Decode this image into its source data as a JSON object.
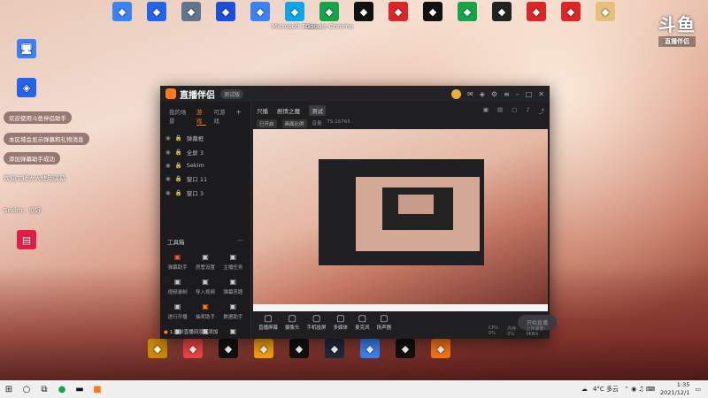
{
  "desktop_icons_top": [
    {
      "label": "",
      "icon": "user-icon",
      "color": "#3b82f6"
    },
    {
      "label": "",
      "icon": "computer-icon",
      "color": "#2563eb"
    },
    {
      "label": "",
      "icon": "recycle-icon",
      "color": "#64748b"
    },
    {
      "label": "",
      "icon": "app-icon",
      "color": "#1d4ed8"
    },
    {
      "label": "",
      "icon": "feishu-icon",
      "color": "#3b82f6"
    },
    {
      "label": "Microsoft Edge",
      "icon": "edge-icon",
      "color": "#0ea5e9"
    },
    {
      "label": "Google Chrome",
      "icon": "chrome-icon",
      "color": "#16a34a"
    },
    {
      "label": "",
      "icon": "capcut-icon",
      "color": "#111111"
    },
    {
      "label": "",
      "icon": "wps-icon",
      "color": "#dc2626"
    },
    {
      "label": "",
      "icon": "qq-icon",
      "color": "#111111"
    },
    {
      "label": "",
      "icon": "wechat-icon",
      "color": "#16a34a"
    },
    {
      "label": "",
      "icon": "obs-icon",
      "color": "#222222"
    },
    {
      "label": "",
      "icon": "wps-office-icon",
      "color": "#dc2626"
    },
    {
      "label": "",
      "icon": "netease-icon",
      "color": "#dc2626"
    },
    {
      "label": "",
      "icon": "folder-icon",
      "color": "#e5c07b"
    }
  ],
  "desktop_icons_bottom": [
    {
      "label": "",
      "icon": "app-a-icon",
      "color": "#ca8a04"
    },
    {
      "label": "",
      "icon": "app-b-icon",
      "color": "#ef4444"
    },
    {
      "label": "",
      "icon": "app-c-icon",
      "color": "#111111"
    },
    {
      "label": "",
      "icon": "app-d-icon",
      "color": "#f59e0b"
    },
    {
      "label": "",
      "icon": "app-e-icon",
      "color": "#111111"
    },
    {
      "label": "",
      "icon": "app-f-icon",
      "color": "#1e293b"
    },
    {
      "label": "",
      "icon": "app-g-icon",
      "color": "#3b82f6"
    },
    {
      "label": "",
      "icon": "app-h-icon",
      "color": "#111111"
    },
    {
      "label": "",
      "icon": "app-i-icon",
      "color": "#f97316"
    }
  ],
  "left_overlay": {
    "lines": [
      "欢迎使用斗鱼伴侣助手",
      "本区域会显示弹幕和礼物消息",
      "添加弹幕助手成功",
      "欢迎主播大大使用弹幕"
    ],
    "user_line": "Sekim：你好"
  },
  "logo": {
    "big": "斗鱼",
    "sub": "直播伴侣"
  },
  "app": {
    "title": "直播伴侣",
    "version": "测试版",
    "sidebar_tabs": [
      "我的场景",
      "游戏",
      "可游戏"
    ],
    "scenes": [
      "弹幕框",
      "全屏 3",
      "Sekim",
      "窗口 11",
      "窗口 3"
    ],
    "tools_title": "工具箱",
    "tools": [
      {
        "label": "弹幕助手",
        "icon": "danmaku-icon"
      },
      {
        "label": "房管设置",
        "icon": "user-admin-icon"
      },
      {
        "label": "主播任务",
        "icon": "task-icon"
      },
      {
        "label": "视频录制",
        "icon": "record-icon"
      },
      {
        "label": "导入视频",
        "icon": "import-icon"
      },
      {
        "label": "弹幕答题",
        "icon": "quiz-icon"
      },
      {
        "label": "进行开播",
        "icon": "live-icon"
      },
      {
        "label": "抽奖助手",
        "icon": "gift-icon"
      },
      {
        "label": "数据助手",
        "icon": "data-icon"
      },
      {
        "label": "",
        "icon": "cloud-icon"
      },
      {
        "label": "",
        "icon": "link-icon"
      },
      {
        "label": "",
        "icon": "more-icon"
      }
    ],
    "warning": "1.当前直播间没有添加",
    "header": {
      "label": "只播",
      "title": "剧情之魔",
      "badge": "测试"
    },
    "subbar": [
      "已开启",
      "画面比例",
      "音量",
      "TS:16765"
    ],
    "bottom_buttons": [
      {
        "label": "直播屏幕",
        "icon": "screen-icon"
      },
      {
        "label": "摄像头",
        "icon": "camera-icon"
      },
      {
        "label": "手机投屏",
        "icon": "phone-icon"
      },
      {
        "label": "多媒体",
        "icon": "media-icon"
      },
      {
        "label": "麦克风",
        "icon": "mic-icon"
      },
      {
        "label": "扬声器",
        "icon": "speaker-icon"
      }
    ],
    "start_label": "开始直播",
    "status": [
      "CPU: 0%",
      "内存: 0%",
      "上传速度: 0KB/s"
    ]
  },
  "taskbar": {
    "weather": "4°C 多云",
    "time": "1:35",
    "date": "2021/12/1"
  }
}
